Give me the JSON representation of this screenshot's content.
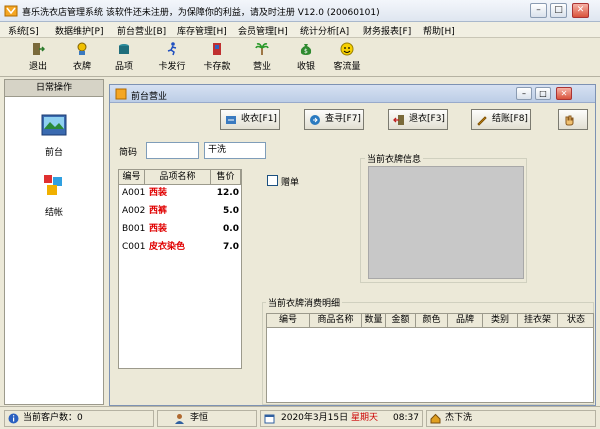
{
  "app": {
    "title": "喜乐洗衣店管理系统    该软件还未注册，为保障你的利益，请及时注册  V12.0 (20060101)"
  },
  "window_controls": {
    "minimize": "–",
    "maximize": "□",
    "close": "✕"
  },
  "menu": [
    "系统[S]",
    "数据维护[P]",
    "前台营业[B]",
    "库存管理[H]",
    "会员管理[H]",
    "统计分析[A]",
    "财务报表[F]",
    "帮助[H]"
  ],
  "toolbar": [
    {
      "label": "退出",
      "icon": "exit-icon"
    },
    {
      "label": "衣牌",
      "icon": "hanger-icon"
    },
    {
      "label": "品项",
      "icon": "pot-icon"
    },
    {
      "label": "卡发行",
      "icon": "runner-icon"
    },
    {
      "label": "卡存款",
      "icon": "deposit-icon"
    },
    {
      "label": "营业",
      "icon": "palm-icon"
    },
    {
      "label": "收银",
      "icon": "moneybag-icon"
    },
    {
      "label": "客流量",
      "icon": "smiley-icon"
    }
  ],
  "left_panel": {
    "title": "日常操作",
    "items": [
      {
        "label": "前台",
        "icon": "frontdesk-icon"
      },
      {
        "label": "结帐",
        "icon": "checkout-icon"
      }
    ]
  },
  "child_window": {
    "title": "前台营业",
    "buttons": [
      {
        "label": "收衣[F1]",
        "icon": "receive-icon"
      },
      {
        "label": "查寻[F7]",
        "icon": "search-icon"
      },
      {
        "label": "退衣[F3]",
        "icon": "return-icon"
      },
      {
        "label": "结账[F8]",
        "icon": "pencil-icon"
      }
    ],
    "code_label": "简码",
    "code_value": "",
    "item_name_value": "干洗",
    "item_table": {
      "headers": [
        "编号",
        "品项名称",
        "售价"
      ],
      "rows": [
        {
          "code": "A001",
          "name": "西装",
          "price": "12.0"
        },
        {
          "code": "A002",
          "name": "西裤",
          "price": "5.0"
        },
        {
          "code": "B001",
          "name": "西装",
          "price": "0.0"
        },
        {
          "code": "C001",
          "name": "皮衣染色",
          "price": "7.0"
        }
      ]
    },
    "gift_checkbox_label": "赠单",
    "gift_checked": false,
    "tag_info_label": "当前衣牌信息",
    "detail_label": "当前衣牌消费明细",
    "detail_headers": [
      "编号",
      "商品名称",
      "数量",
      "金额",
      "颜色",
      "品牌",
      "类别",
      "挂衣架",
      "状态"
    ]
  },
  "status_bar": {
    "customers": "当前客户数：0",
    "user": "李恒",
    "date": "2020年3月15日",
    "weekday": "星期天",
    "time": "08:37",
    "extra": "杰下洗"
  },
  "colors": {
    "red_item": "#e00000",
    "weekday": "#cc0000"
  }
}
